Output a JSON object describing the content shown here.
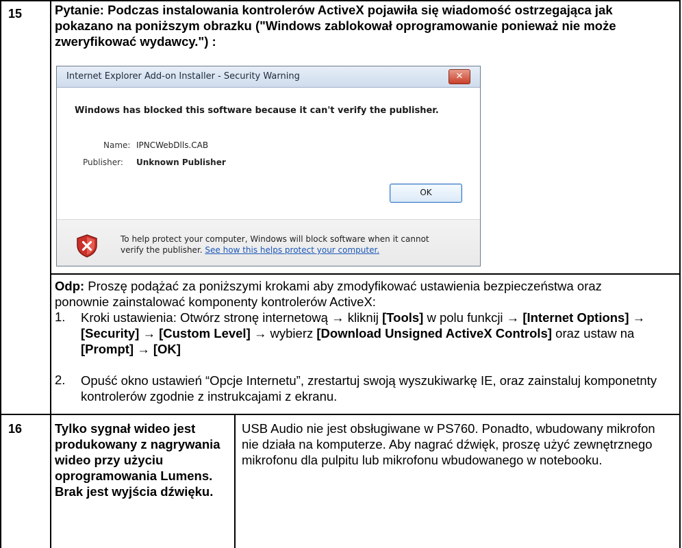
{
  "rows": [
    {
      "number": "15",
      "question": "Pytanie: Podczas instalowania kontrolerów ActiveX pojawiła się wiadomość ostrzegająca jak pokazano na poniższym obrazku (\"Windows zablokował oprogramowanie ponieważ nie może zweryfikować wydawcy.\") :",
      "dialog": {
        "title": "Internet Explorer Add-on Installer - Security Warning",
        "close_glyph": "✕",
        "message": "Windows has blocked this software because it can't verify the publisher.",
        "name_label": "Name:",
        "name_value": "IPNCWebDlls.CAB",
        "publisher_label": "Publisher:",
        "publisher_value": "Unknown Publisher",
        "ok_label": "OK",
        "footer_line1": "To help protect your computer, Windows will block software when it cannot",
        "footer_line2_prefix": "verify the publisher.",
        "footer_link": "See how this helps protect your computer.",
        "icon": "shield-error-icon",
        "colors": {
          "link": "#1b57b8",
          "close_button": "#c8402a"
        }
      },
      "answer_label": "Odp:",
      "answer_intro": " Proszę podążać za poniższymi krokami aby zmodyfikować ustawienia bezpieczeństwa oraz ponownie zainstalować komponenty kontrolerów ActiveX:",
      "steps": [
        {
          "number": "1.",
          "t1": "Kroki ustawienia: Otwórz stronę internetową → kliknij ",
          "b1": "[Tools]",
          "t2": " w polu funkcji → ",
          "b2": "[Internet Options]",
          "t3": " → ",
          "b3": "[Security]",
          "t4": " → ",
          "b4": "[Custom Level]",
          "t5": " → wybierz ",
          "b5": "[Download Unsigned ActiveX Controls]",
          "t6": " oraz ustaw na ",
          "b6": "[Prompt]",
          "t7": " → ",
          "b7": "[OK]"
        },
        {
          "number": "2.",
          "text": "Opuść okno ustawień “Opcje Internetu”, zrestartuj swoją wyszukiwarkę IE, oraz zainstaluj komponetnty kontrolerów zgodnie z instrukcajami z ekranu."
        }
      ]
    },
    {
      "number": "16",
      "question": "Tylko sygnał wideo jest produkowany z nagrywania wideo przy użyciu oprogramowania Lumens. Brak jest wyjścia dźwięku.",
      "answer": "USB Audio nie jest obsługiwane w PS760. Ponadto, wbudowany mikrofon nie działa na komputerze. Aby nagrać dźwięk, proszę użyć zewnętrznego mikrofonu dla pulpitu lub mikrofonu wbudowanego w notebooku."
    }
  ]
}
